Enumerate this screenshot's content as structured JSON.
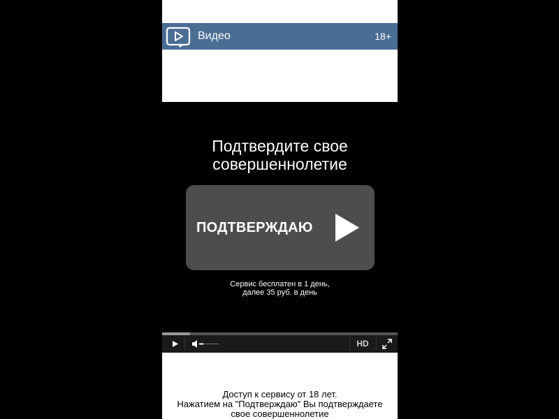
{
  "header": {
    "title": "Видео",
    "age_badge": "18+",
    "logo_icon": "video-play-icon",
    "background": "#4a6d94"
  },
  "player": {
    "title_line1": "Подтвердите свое",
    "title_line2": "совершеннолетие",
    "confirm_button_label": "ПОДТВЕРЖДАЮ",
    "pricing_line1": "Сервис бесплатен в 1 день,",
    "pricing_line2": "далее 35 руб. в день",
    "progress": 0.12,
    "controls": {
      "play_icon": "play-icon",
      "volume_icon": "volume-icon",
      "hd_label": "HD",
      "fullscreen_icon": "fullscreen-icon"
    }
  },
  "footer": {
    "line1": "Доступ к сервису от 18 лет.",
    "line2": "Нажатием на \"Подтверждаю\" Вы подтверждаете",
    "line3": "свое совершеннолетие"
  }
}
